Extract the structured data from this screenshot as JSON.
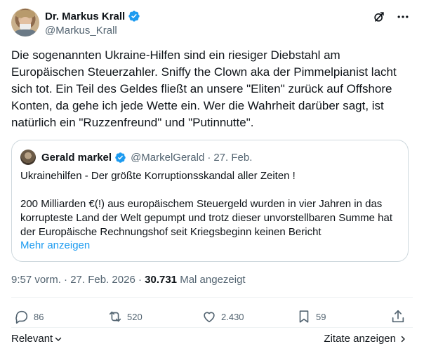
{
  "author": {
    "name": "Dr. Markus Krall",
    "handle": "@Markus_Krall"
  },
  "tweet": {
    "text": "Die sogenannten Ukraine-Hilfen sind ein riesiger Diebstahl am Europäischen Steuerzahler. Sniffy the Clown aka der Pimmelpianist lacht sich tot. Ein Teil des Geldes fließt an unsere \"Eliten\" zurück auf Offshore Konten, da gehe ich jede Wette ein. Wer die Wahrheit darüber sagt, ist natürlich ein \"Ruzzenfreund\" und \"Putinnutte\"."
  },
  "quote": {
    "name": "Gerald markel",
    "handle": "@MarkelGerald",
    "separator": "·",
    "date": "27. Feb.",
    "line1": "Ukrainehilfen - Der größte Korruptionsskandal aller Zeiten !",
    "line2": "200 Milliarden €(!) aus europäischem Steuergeld wurden in vier Jahren in das korrupteste Land der Welt gepumpt und trotz dieser unvorstellbaren Summe hat der Europäische Rechnungshof seit Kriegsbeginn keinen Bericht",
    "more": "Mehr anzeigen"
  },
  "meta": {
    "time": "9:57 vorm.",
    "separator": "·",
    "date": "27. Feb. 2026",
    "views_count": "30.731",
    "views_label": "Mal angezeigt"
  },
  "actions": {
    "replies": "86",
    "reposts": "520",
    "likes": "2.430",
    "bookmarks": "59"
  },
  "footer": {
    "sort_label": "Relevant",
    "quotes_label": "Zitate anzeigen"
  },
  "colors": {
    "accent": "#1d9bf0",
    "text": "#0f1419",
    "muted": "#536471",
    "border": "#cfd9de"
  }
}
